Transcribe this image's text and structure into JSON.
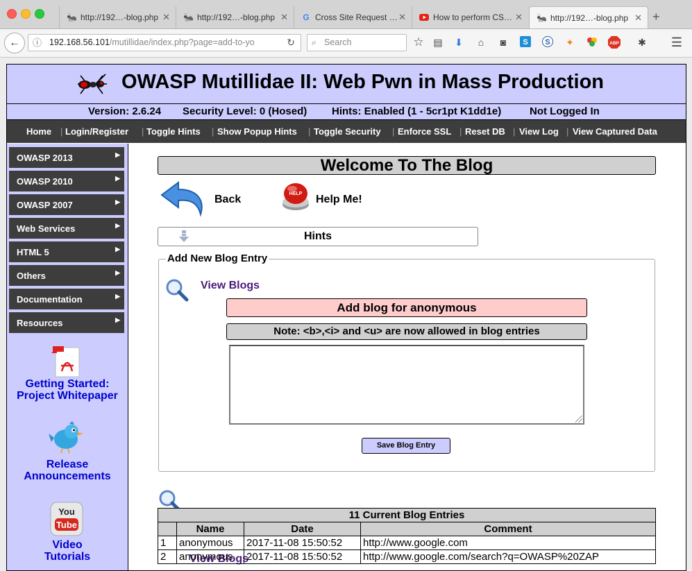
{
  "browser": {
    "tabs": [
      {
        "title": "http://192…-blog.php",
        "icon": "ant-icon",
        "active": false
      },
      {
        "title": "http://192…-blog.php",
        "icon": "ant-icon",
        "active": false
      },
      {
        "title": "Cross Site Request …",
        "icon": "google-icon",
        "active": false
      },
      {
        "title": "How to perform CS…",
        "icon": "youtube-icon",
        "active": false
      },
      {
        "title": "http://192…-blog.php",
        "icon": "ant-icon",
        "active": true
      }
    ],
    "url_host": "192.168.56.101",
    "url_rest": "/mutillidae/index.php?page=add-to-yo",
    "search_placeholder": "Search"
  },
  "site": {
    "title": "OWASP Mutillidae II: Web Pwn in Mass Production",
    "version": "Version: 2.6.24",
    "security": "Security Level: 0 (Hosed)",
    "hints": "Hints: Enabled (1 - 5cr1pt K1dd1e)",
    "login_status": "Not Logged In",
    "menu": [
      "Home",
      "Login/Register",
      "Toggle Hints",
      "Show Popup Hints",
      "Toggle Security",
      "Enforce SSL",
      "Reset DB",
      "View Log",
      "View Captured Data"
    ]
  },
  "sidebar": {
    "items": [
      "OWASP 2013",
      "OWASP 2010",
      "OWASP 2007",
      "Web Services",
      "HTML 5",
      "Others",
      "Documentation",
      "Resources"
    ],
    "whitepaper_line1": "Getting Started:",
    "whitepaper_line2": "Project Whitepaper",
    "release_line1": "Release",
    "release_line2": "Announcements",
    "video_line1": "Video",
    "video_line2": "Tutorials",
    "youtube_you": "You",
    "youtube_tube": "Tube",
    "help_badge": "HELP"
  },
  "main": {
    "title": "Welcome To The Blog",
    "back_label": "Back",
    "help_label": "Help Me!",
    "hints_label": "Hints",
    "fieldset_legend": "Add New Blog Entry",
    "view_blogs": "View Blogs",
    "add_blog_heading": "Add blog for anonymous",
    "note": "Note: <b>,<i> and <u> are now allowed in blog entries",
    "textarea_value": "",
    "save_button": "Save Blog Entry",
    "view_blogs_2": "View Blogs"
  },
  "table": {
    "caption": "11 Current Blog Entries",
    "headers": [
      "",
      "Name",
      "Date",
      "Comment"
    ],
    "rows": [
      [
        "1",
        "anonymous",
        "2017-11-08 15:50:52",
        "http://www.google.com"
      ],
      [
        "2",
        "anonymous",
        "2017-11-08 15:50:52",
        "http://www.google.com/search?q=OWASP%20ZAP"
      ]
    ]
  },
  "colors": {
    "header_bg": "#ccccff",
    "menu_bg": "#3d3d3d",
    "link": "#0000cc",
    "visited_link": "#4b1a7a",
    "add_blog_bg": "#ffcccc"
  }
}
